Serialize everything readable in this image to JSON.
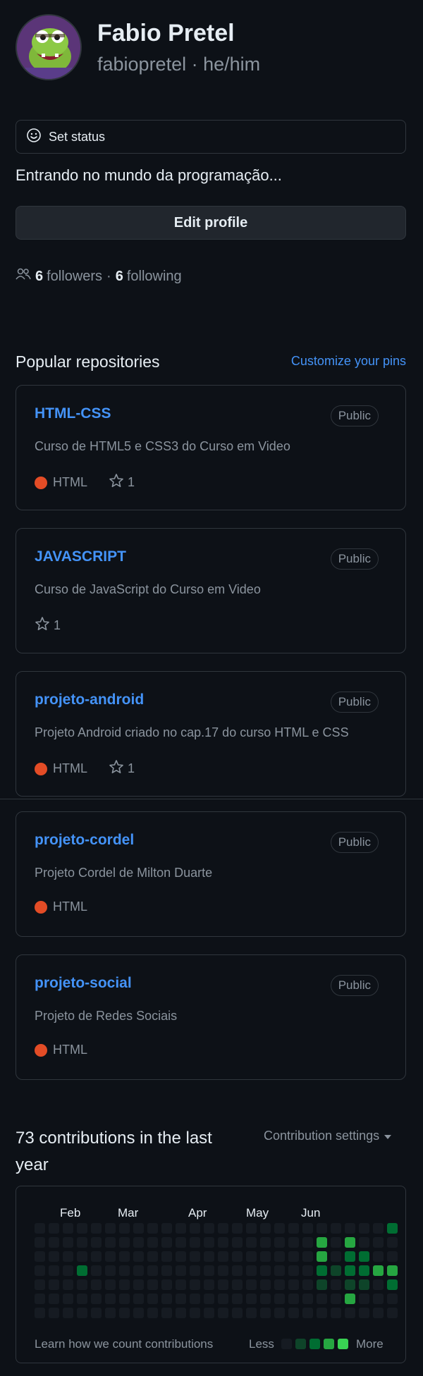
{
  "profile": {
    "name": "Fabio Pretel",
    "handle": "fabiopretel · he/him",
    "bio": "Entrando no mundo da programação...",
    "set_status_label": "Set status",
    "edit_profile_label": "Edit profile",
    "followers_count": "6",
    "followers_label": "followers",
    "separator": "·",
    "following_count": "6",
    "following_label": "following"
  },
  "popular": {
    "title": "Popular repositories",
    "customize_label": "Customize your pins",
    "repos": [
      {
        "name": "HTML-CSS",
        "badge": "Public",
        "description": "Curso de HTML5 e CSS3 do Curso em Video",
        "language": "HTML",
        "stars": "1"
      },
      {
        "name": "JAVASCRIPT",
        "badge": "Public",
        "description": "Curso de JavaScript do Curso em Video",
        "language": "",
        "stars": "1"
      },
      {
        "name": "projeto-android",
        "badge": "Public",
        "description": "Projeto Android criado no cap.17 do curso HTML e CSS",
        "language": "HTML",
        "stars": "1"
      },
      {
        "name": "projeto-cordel",
        "badge": "Public",
        "description": "Projeto Cordel de Milton Duarte",
        "language": "HTML",
        "stars": ""
      },
      {
        "name": "projeto-social",
        "badge": "Public",
        "description": "Projeto de Redes Sociais",
        "language": "HTML",
        "stars": ""
      }
    ]
  },
  "contributions": {
    "title": "73 contributions in the last year",
    "settings_label": "Contribution settings",
    "months": [
      "Feb",
      "Mar",
      "Apr",
      "May",
      "Jun"
    ],
    "learn_label": "Learn how we count contributions",
    "less_label": "Less",
    "more_label": "More",
    "grid": [
      [
        0,
        0,
        0,
        0,
        0,
        0,
        0,
        0,
        0,
        0,
        0,
        0,
        0,
        0,
        0,
        0,
        0,
        0,
        0,
        0,
        0,
        0,
        0,
        0,
        0,
        2
      ],
      [
        0,
        0,
        0,
        0,
        0,
        0,
        0,
        0,
        0,
        0,
        0,
        0,
        0,
        0,
        0,
        0,
        0,
        0,
        0,
        0,
        3,
        0,
        3,
        0,
        0,
        0
      ],
      [
        0,
        0,
        0,
        0,
        0,
        0,
        0,
        0,
        0,
        0,
        0,
        0,
        0,
        0,
        0,
        0,
        0,
        0,
        0,
        0,
        3,
        0,
        2,
        2,
        0,
        0
      ],
      [
        0,
        0,
        0,
        2,
        0,
        0,
        0,
        0,
        0,
        0,
        0,
        0,
        0,
        0,
        0,
        0,
        0,
        0,
        0,
        0,
        2,
        1,
        2,
        2,
        3,
        3
      ],
      [
        0,
        0,
        0,
        0,
        0,
        0,
        0,
        0,
        0,
        0,
        0,
        0,
        0,
        0,
        0,
        0,
        0,
        0,
        0,
        0,
        1,
        0,
        1,
        1,
        0,
        2
      ],
      [
        0,
        0,
        0,
        0,
        0,
        0,
        0,
        0,
        0,
        0,
        0,
        0,
        0,
        0,
        0,
        0,
        0,
        0,
        0,
        0,
        0,
        0,
        3,
        0,
        0,
        0
      ],
      [
        0,
        0,
        0,
        0,
        0,
        0,
        0,
        0,
        0,
        0,
        0,
        0,
        0,
        0,
        0,
        0,
        0,
        0,
        0,
        0,
        0,
        0,
        0,
        0,
        0,
        0
      ]
    ]
  },
  "colors": {
    "bg": "#0d1117",
    "border": "#30363d",
    "link": "#4493f8",
    "muted": "#8b949e",
    "html_lang": "#e34c26",
    "levels": [
      "#161b22",
      "#0e4429",
      "#006d32",
      "#26a641",
      "#39d353"
    ]
  },
  "icons": {
    "status": "smiley-icon",
    "followers": "people-icon",
    "star": "star-icon",
    "dropdown": "triangle-down-icon"
  }
}
